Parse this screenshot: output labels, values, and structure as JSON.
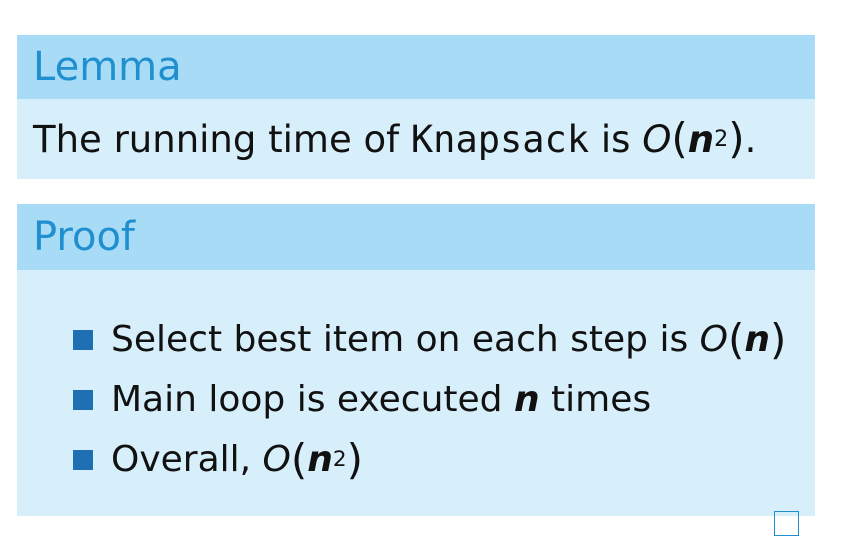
{
  "lemma": {
    "title": "Lemma",
    "statement_prefix": "The running time of ",
    "algorithm": "Knapsack",
    "statement_mid": " is ",
    "big_o": "O",
    "open_paren": "(",
    "var": "n",
    "exponent": "2",
    "close_paren": ")",
    "period": "."
  },
  "proof": {
    "title": "Proof",
    "items": [
      {
        "text": "Select best item on each step is ",
        "big_o": "O",
        "open_paren": "(",
        "var": "n",
        "close_paren": ")"
      },
      {
        "text_before": "Main loop is executed ",
        "var": "n",
        "text_after": " times"
      },
      {
        "text": "Overall, ",
        "big_o": "O",
        "open_paren": "(",
        "var": "n",
        "exponent": "2",
        "close_paren": ")"
      }
    ]
  },
  "colors": {
    "title_bg": "#a8dcf6",
    "title_text": "#1f8fd0",
    "body_bg": "#d7eefb",
    "bullet": "#1f6fb3"
  }
}
